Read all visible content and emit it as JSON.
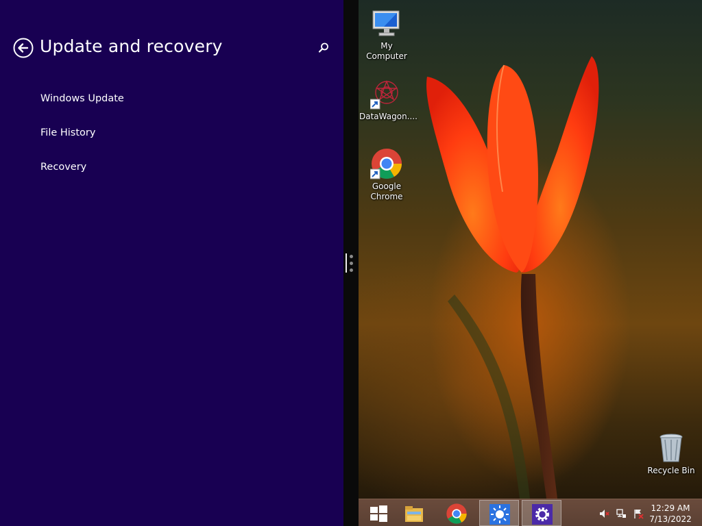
{
  "settings": {
    "title": "Update and recovery",
    "nav_items": [
      {
        "label": "Windows Update"
      },
      {
        "label": "File History"
      },
      {
        "label": "Recovery"
      }
    ]
  },
  "desktop": {
    "icons": [
      {
        "label": "My Computer",
        "icon": "computer-icon"
      },
      {
        "label": "DataWagon....",
        "icon": "datawagon-icon"
      },
      {
        "label": "Google Chrome",
        "icon": "chrome-icon"
      },
      {
        "label": "Recycle Bin",
        "icon": "recycle-bin-icon"
      }
    ]
  },
  "taskbar": {
    "buttons": [
      {
        "name": "start-button",
        "icon": "windows-logo-icon"
      },
      {
        "name": "file-explorer-button",
        "icon": "folder-icon"
      },
      {
        "name": "chrome-taskbar-button",
        "icon": "chrome-icon"
      },
      {
        "name": "brightness-app-button",
        "icon": "sun-icon"
      },
      {
        "name": "settings-app-button",
        "icon": "gear-icon",
        "active": true
      }
    ],
    "tray": [
      "volume-muted-icon",
      "network-icon",
      "action-center-flag-icon"
    ],
    "clock": {
      "time": "12:29 AM",
      "date": "7/13/2022"
    }
  },
  "colors": {
    "pane_background": "#180052",
    "taskbar": "#5b4033",
    "accent": "#4b2aa8"
  }
}
